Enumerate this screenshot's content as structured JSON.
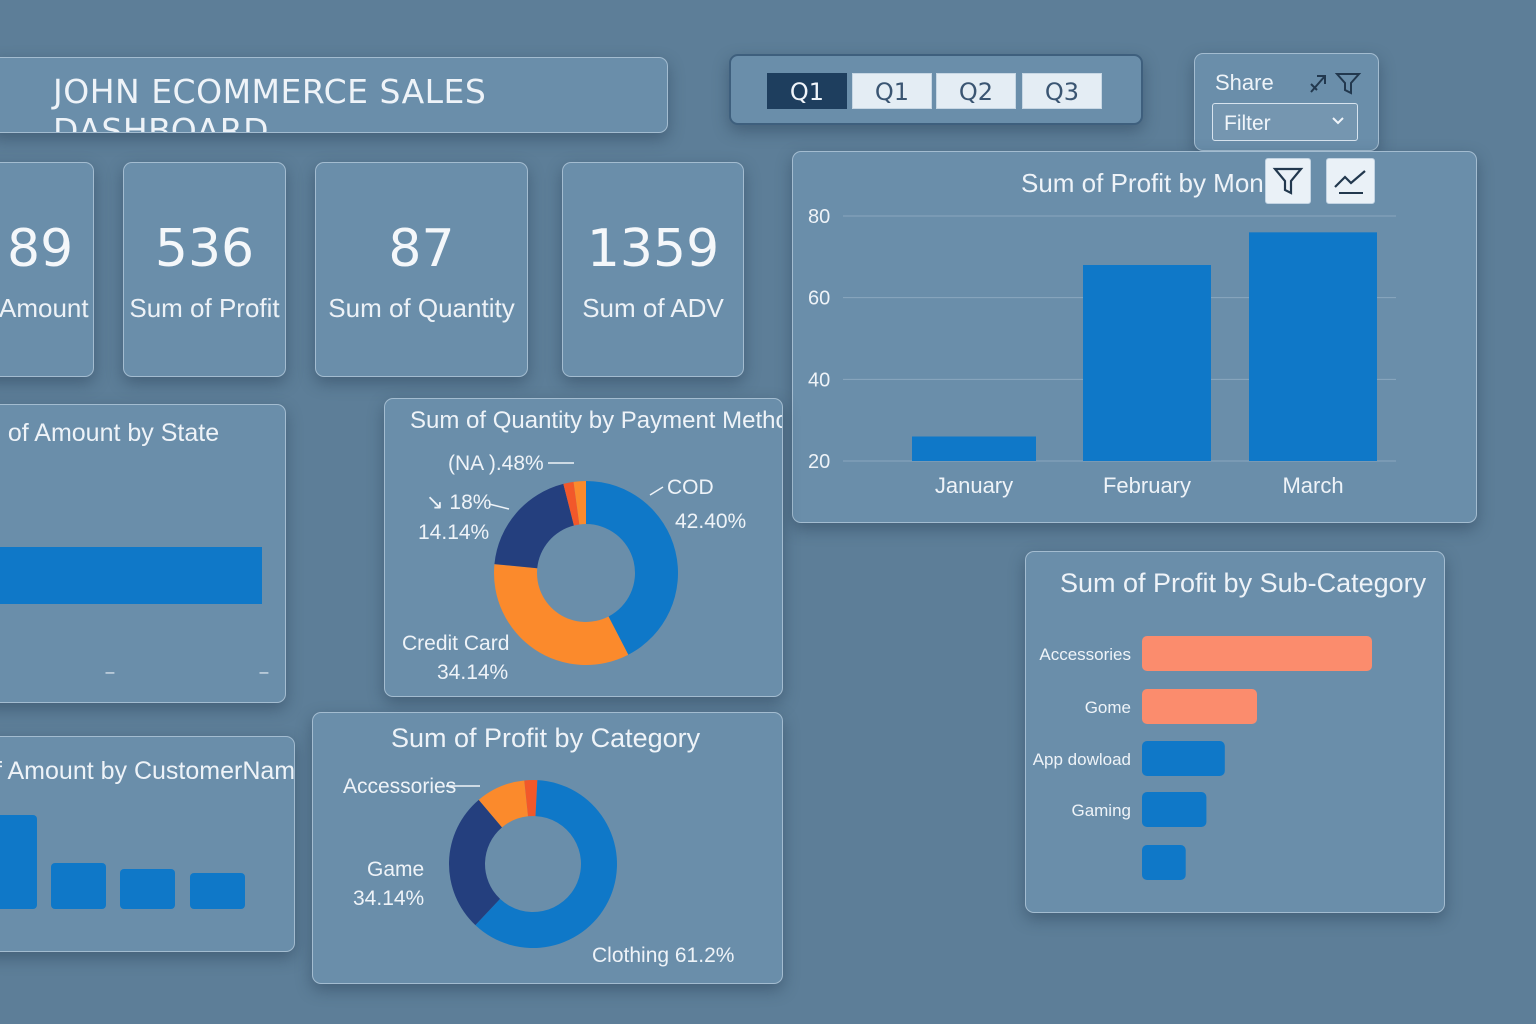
{
  "header": {
    "title": "JOHN ECOMMERCE SALES DASHBOARD"
  },
  "quarter_slicer": {
    "buttons": [
      {
        "label": "Q1",
        "active": true
      },
      {
        "label": "Q1",
        "active": false
      },
      {
        "label": "Q2",
        "active": false
      },
      {
        "label": "Q3",
        "active": false
      }
    ]
  },
  "share_panel": {
    "share_label": "Share",
    "filter_value": "Filter",
    "icons": [
      "share-arrow-icon",
      "filter-funnel-icon",
      "chevron-down-icon"
    ]
  },
  "kpis": [
    {
      "value": "89",
      "label": "Amount"
    },
    {
      "value": "536",
      "label": "Sum of Profit"
    },
    {
      "value": "87",
      "label": "Sum of Quantity"
    },
    {
      "value": "1359",
      "label": "Sum of ADV"
    }
  ],
  "colors": {
    "background": "#5d7e98",
    "card": "#6a8eaa",
    "blue": "#0f78c8",
    "navy": "#243f7e",
    "orange": "#fb8a2c",
    "salmon": "#fb8c6d",
    "accent_red": "#f2582a"
  },
  "chart_data": [
    {
      "id": "profit-by-month",
      "type": "bar",
      "title": "Sum of Profit by Mon",
      "categories": [
        "January",
        "February",
        "March"
      ],
      "values": [
        26,
        68,
        76
      ],
      "ylim": [
        20,
        80
      ],
      "yticks": [
        "80",
        "60",
        "40",
        "20"
      ],
      "grid": true,
      "toolbar_icons": [
        "filter-funnel-icon",
        "trend-line-icon"
      ]
    },
    {
      "id": "amount-by-state",
      "type": "bar",
      "title": "n of Amount by State",
      "orientation": "horizontal",
      "values": [
        1
      ],
      "tick_marks": [
        "–",
        "–"
      ]
    },
    {
      "id": "quantity-by-payment",
      "type": "pie",
      "title": "Sum of Quantity by Payment Method",
      "slices": [
        {
          "label": "COD",
          "value_label": "42.40%",
          "value": 42.4,
          "color": "#0f78c8"
        },
        {
          "label": "Credit Card",
          "value_label": "34.14%",
          "value": 34.14,
          "color": "#fb8a2c"
        },
        {
          "label": "↘ 18%",
          "value_label": "14.14%",
          "value": 19.5,
          "color": "#243f7e"
        },
        {
          "label": "(NA ).48%",
          "value_label": "",
          "value": 1.8,
          "color": "#f2582a"
        },
        {
          "label": "",
          "value_label": "",
          "value": 2.16,
          "color": "#fb8a2c"
        }
      ]
    },
    {
      "id": "profit-by-category",
      "type": "pie",
      "title": "Sum of Profit by Category",
      "slices": [
        {
          "label": "Clothing",
          "value_label": "Clothing 61.2%",
          "value": 61.2,
          "color": "#0f78c8"
        },
        {
          "label": "Game",
          "value_label": "34.14%",
          "value": 26.8,
          "color": "#243f7e"
        },
        {
          "label": "Accessories",
          "value_label": "",
          "value": 9.5,
          "color": "#fb8a2c"
        },
        {
          "label": "",
          "value_label": "",
          "value": 2.5,
          "color": "#f2582a"
        }
      ]
    },
    {
      "id": "amount-by-customer",
      "type": "bar",
      "title": "f Amount by CustomerName",
      "values": [
        94,
        46,
        40,
        36
      ]
    },
    {
      "id": "profit-by-subcategory",
      "type": "bar",
      "orientation": "horizontal",
      "title": "Sum of Profit by Sub-Category",
      "categories": [
        "Accessories",
        "Gome",
        "App dowload",
        "Gaming",
        ""
      ],
      "values": [
        100,
        50,
        36,
        28,
        19
      ],
      "colors": [
        "#fb8c6d",
        "#fb8c6d",
        "#0f78c8",
        "#0f78c8",
        "#0f78c8"
      ]
    }
  ]
}
